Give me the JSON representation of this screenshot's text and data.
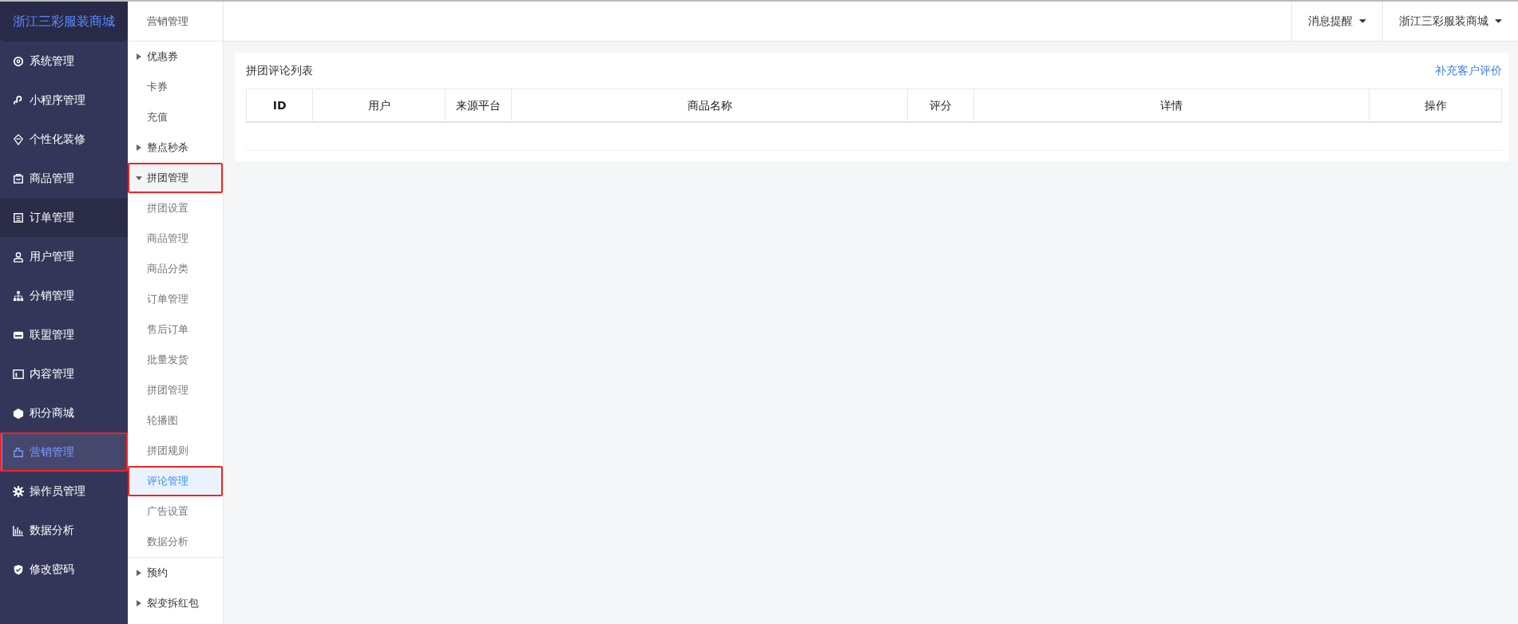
{
  "brand": "浙江三彩服装商城",
  "sidebar": {
    "items": [
      {
        "label": "系统管理",
        "selected": false,
        "hovered": false,
        "annotated": false
      },
      {
        "label": "小程序管理",
        "selected": false,
        "hovered": false,
        "annotated": false
      },
      {
        "label": "个性化装修",
        "selected": false,
        "hovered": false,
        "annotated": false
      },
      {
        "label": "商品管理",
        "selected": false,
        "hovered": false,
        "annotated": false
      },
      {
        "label": "订单管理",
        "selected": false,
        "hovered": true,
        "annotated": false
      },
      {
        "label": "用户管理",
        "selected": false,
        "hovered": false,
        "annotated": false
      },
      {
        "label": "分销管理",
        "selected": false,
        "hovered": false,
        "annotated": false
      },
      {
        "label": "联盟管理",
        "selected": false,
        "hovered": false,
        "annotated": false
      },
      {
        "label": "内容管理",
        "selected": false,
        "hovered": false,
        "annotated": false
      },
      {
        "label": "积分商城",
        "selected": false,
        "hovered": false,
        "annotated": false
      },
      {
        "label": "营销管理",
        "selected": true,
        "hovered": false,
        "annotated": true
      },
      {
        "label": "操作员管理",
        "selected": false,
        "hovered": false,
        "annotated": false
      },
      {
        "label": "数据分析",
        "selected": false,
        "hovered": false,
        "annotated": false
      },
      {
        "label": "修改密码",
        "selected": false,
        "hovered": false,
        "annotated": false
      }
    ]
  },
  "submenu": {
    "title": "营销管理",
    "items": [
      {
        "kind": "group",
        "label": "优惠券",
        "expanded": false,
        "annotated": false
      },
      {
        "kind": "item",
        "label": "卡券",
        "selected": false,
        "annotated": false
      },
      {
        "kind": "item",
        "label": "充值",
        "selected": false,
        "annotated": false
      },
      {
        "kind": "group",
        "label": "整点秒杀",
        "expanded": false,
        "annotated": false
      },
      {
        "kind": "group",
        "label": "拼团管理",
        "expanded": true,
        "annotated": true,
        "children": [
          {
            "label": "拼团设置",
            "selected": false,
            "annotated": false
          },
          {
            "label": "商品管理",
            "selected": false,
            "annotated": false
          },
          {
            "label": "商品分类",
            "selected": false,
            "annotated": false
          },
          {
            "label": "订单管理",
            "selected": false,
            "annotated": false
          },
          {
            "label": "售后订单",
            "selected": false,
            "annotated": false
          },
          {
            "label": "批量发货",
            "selected": false,
            "annotated": false
          },
          {
            "label": "拼团管理",
            "selected": false,
            "annotated": false
          },
          {
            "label": "轮播图",
            "selected": false,
            "annotated": false
          },
          {
            "label": "拼团规则",
            "selected": false,
            "annotated": false
          },
          {
            "label": "评论管理",
            "selected": true,
            "annotated": true
          },
          {
            "label": "广告设置",
            "selected": false,
            "annotated": false
          },
          {
            "label": "数据分析",
            "selected": false,
            "annotated": false
          }
        ]
      },
      {
        "kind": "group",
        "label": "预约",
        "expanded": false,
        "annotated": false
      },
      {
        "kind": "group",
        "label": "裂变拆红包",
        "expanded": false,
        "annotated": false
      }
    ]
  },
  "topbar": {
    "menus": [
      "消息提醒",
      "浙江三彩服装商城"
    ]
  },
  "panel": {
    "title": "拼团评论列表",
    "action": "补充客户评价",
    "table": {
      "columns": [
        "ID",
        "用户",
        "来源平台",
        "商品名称",
        "评分",
        "详情",
        "操作"
      ]
    }
  }
}
